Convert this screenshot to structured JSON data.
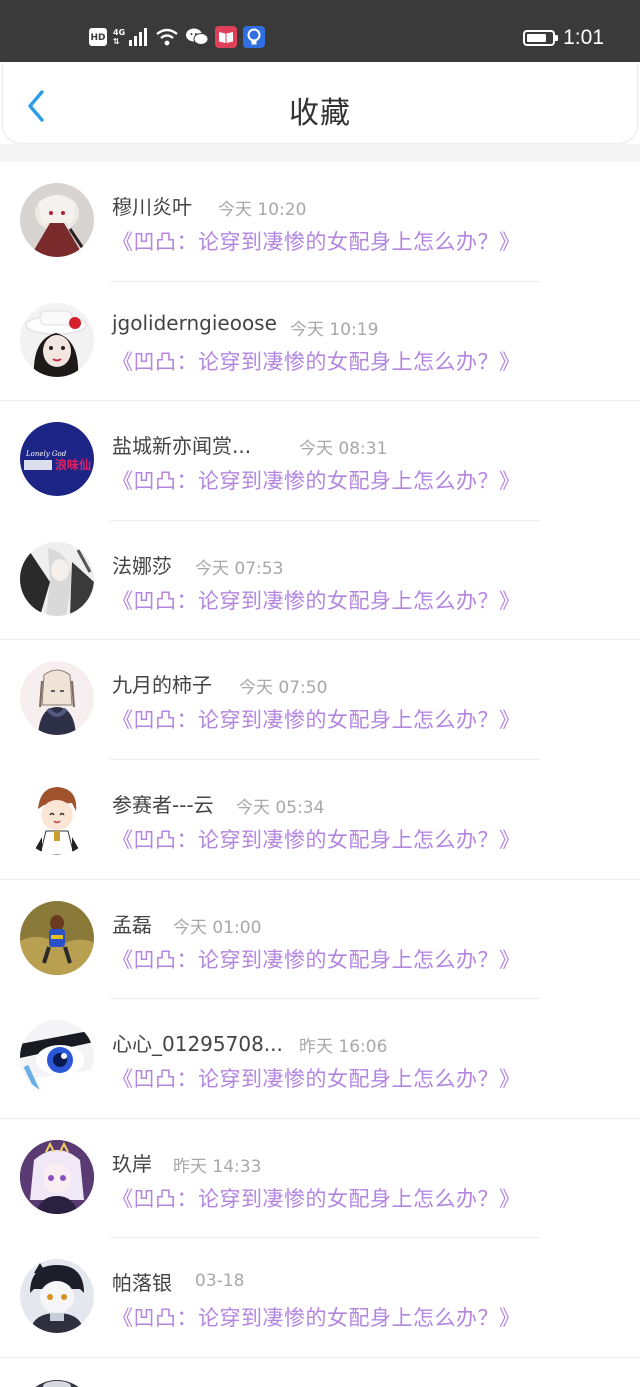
{
  "status_bar": {
    "hd_label": "HD",
    "network_label": "4G",
    "clock": "1:01",
    "battery_level": 0.8,
    "icons": [
      "hd-icon",
      "signal-icon",
      "wifi-icon",
      "wechat-icon",
      "reader-app-icon",
      "light-app-icon",
      "battery-icon"
    ]
  },
  "header": {
    "title": "收藏",
    "back_icon": "back-chevron-icon",
    "accent_color": "#2a9ce8"
  },
  "colors": {
    "book_title": "#b486e0",
    "time": "#a8a8a8",
    "name": "#444444"
  },
  "favorites": [
    {
      "name": "穆川炎叶",
      "time": "今天 10:20",
      "book": "《凹凸：论穿到凄惨的女配身上怎么办？》"
    },
    {
      "name": "jgoliderngieoose",
      "time": "今天 10:19",
      "book": "《凹凸：论穿到凄惨的女配身上怎么办？》"
    },
    {
      "name": "盐城新亦闻赏...",
      "time": "今天 08:31",
      "book": "《凹凸：论穿到凄惨的女配身上怎么办？》"
    },
    {
      "name": "法娜莎",
      "time": "今天 07:53",
      "book": "《凹凸：论穿到凄惨的女配身上怎么办？》"
    },
    {
      "name": "九月的柿子",
      "time": "今天 07:50",
      "book": "《凹凸：论穿到凄惨的女配身上怎么办？》"
    },
    {
      "name": "参赛者---云",
      "time": "今天 05:34",
      "book": "《凹凸：论穿到凄惨的女配身上怎么办？》"
    },
    {
      "name": "孟磊",
      "time": "今天 01:00",
      "book": "《凹凸：论穿到凄惨的女配身上怎么办？》"
    },
    {
      "name": "心心_01295708...",
      "time": "昨天 16:06",
      "book": "《凹凸：论穿到凄惨的女配身上怎么办？》"
    },
    {
      "name": "玖岸",
      "time": "昨天 14:33",
      "book": "《凹凸：论穿到凄惨的女配身上怎么办？》"
    },
    {
      "name": "帕落银",
      "time": "03-18",
      "book": "《凹凸：论穿到凄惨的女配身上怎么办？》"
    }
  ]
}
